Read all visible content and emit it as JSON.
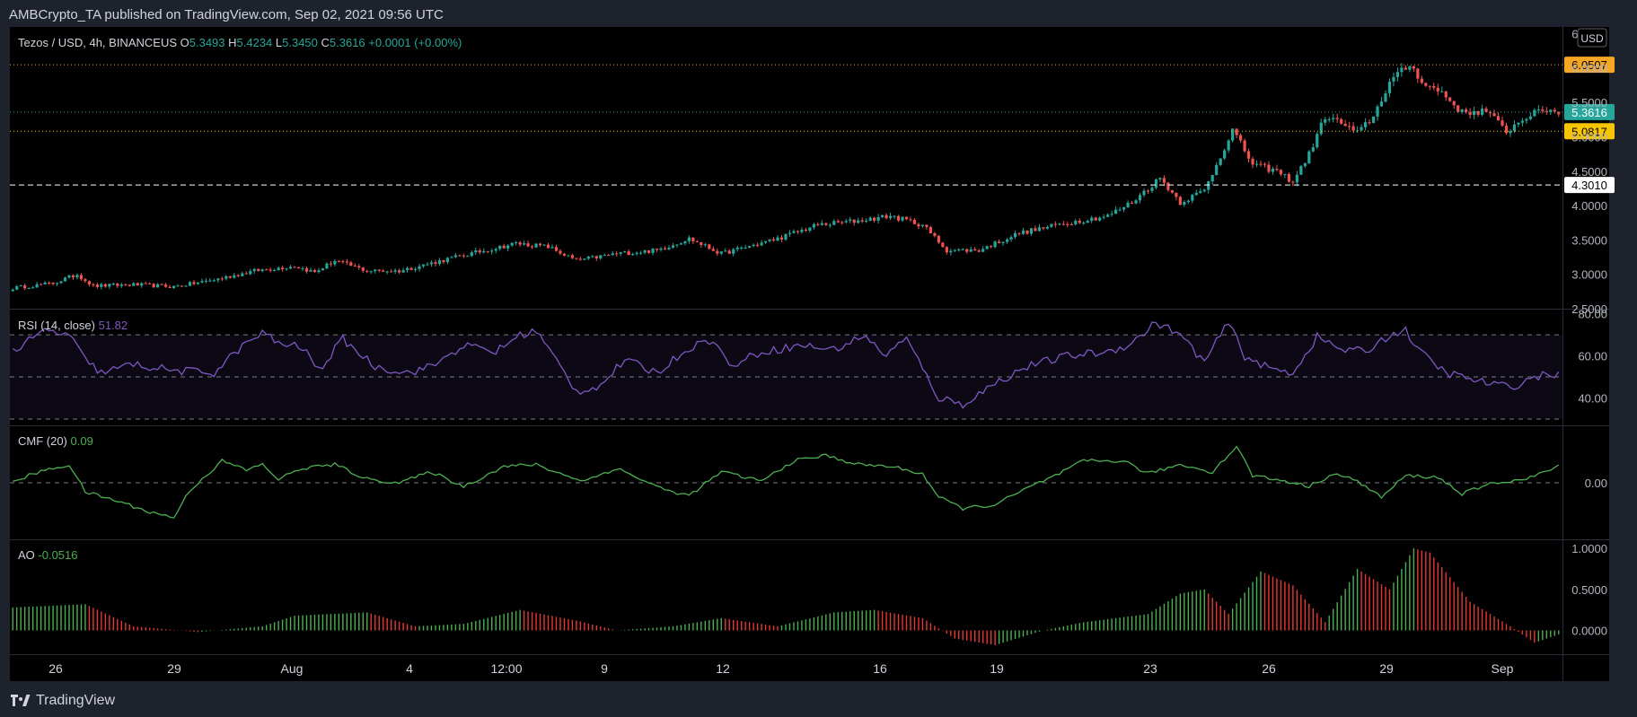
{
  "header": {
    "published_text": "AMBCrypto_TA published on TradingView.com, Sep 02, 2021 09:56 UTC"
  },
  "footer": {
    "brand": "TradingView",
    "logo_icon": "tradingview-logo-icon"
  },
  "colors": {
    "background": "#000000",
    "frame": "#1e222d",
    "up": "#26a69a",
    "down": "#ef5350",
    "rsi": "#7e57c2",
    "cmf": "#4caf50",
    "ao_up": "#4caf50",
    "ao_down": "#e53935",
    "level_yellow": "#f7c600",
    "level_orange": "#f5a623"
  },
  "chart_data": [
    {
      "type": "candlestick",
      "symbol": "Tezos / USD, 4h, BINANCEUS",
      "ohlc_label": {
        "o_label": "O",
        "o_value": "5.3493",
        "h_label": "H",
        "h_value": "5.4234",
        "l_label": "L",
        "l_value": "5.3450",
        "c_label": "C",
        "c_value": "5.3616",
        "change": "+0.0001 (+0.00%)"
      },
      "currency_button": "USD",
      "ylim": [
        2.5,
        6.6
      ],
      "y_ticks": [
        "6.5000",
        "6.0000",
        "5.5000",
        "5.0000",
        "4.5000",
        "4.0000",
        "3.5000",
        "3.0000",
        "2.5000"
      ],
      "x_tick_labels": [
        "26",
        "29",
        "Aug",
        "4",
        "12:00",
        "9",
        "12",
        "16",
        "19",
        "23",
        "26",
        "29",
        "Sep"
      ],
      "close_anchors": [
        [
          0,
          2.8
        ],
        [
          10,
          2.87
        ],
        [
          16,
          3.0
        ],
        [
          20,
          2.83
        ],
        [
          30,
          2.85
        ],
        [
          40,
          2.82
        ],
        [
          50,
          2.92
        ],
        [
          60,
          3.05
        ],
        [
          70,
          3.12
        ],
        [
          75,
          3.03
        ],
        [
          80,
          3.2
        ],
        [
          88,
          3.05
        ],
        [
          96,
          3.05
        ],
        [
          110,
          3.25
        ],
        [
          125,
          3.45
        ],
        [
          133,
          3.4
        ],
        [
          140,
          3.2
        ],
        [
          150,
          3.3
        ],
        [
          160,
          3.35
        ],
        [
          168,
          3.52
        ],
        [
          176,
          3.3
        ],
        [
          190,
          3.52
        ],
        [
          200,
          3.72
        ],
        [
          210,
          3.78
        ],
        [
          218,
          3.85
        ],
        [
          226,
          3.72
        ],
        [
          232,
          3.35
        ],
        [
          240,
          3.35
        ],
        [
          250,
          3.6
        ],
        [
          262,
          3.75
        ],
        [
          272,
          3.85
        ],
        [
          278,
          4.05
        ],
        [
          285,
          4.4
        ],
        [
          290,
          4.05
        ],
        [
          296,
          4.22
        ],
        [
          303,
          5.1
        ],
        [
          308,
          4.6
        ],
        [
          314,
          4.5
        ],
        [
          318,
          4.35
        ],
        [
          322,
          4.75
        ],
        [
          326,
          5.3
        ],
        [
          330,
          5.2
        ],
        [
          334,
          5.05
        ],
        [
          338,
          5.3
        ],
        [
          342,
          5.8
        ],
        [
          347,
          6.05
        ],
        [
          351,
          5.75
        ],
        [
          355,
          5.65
        ],
        [
          360,
          5.35
        ],
        [
          366,
          5.38
        ],
        [
          371,
          5.08
        ],
        [
          376,
          5.3
        ],
        [
          381,
          5.4
        ],
        [
          384,
          5.36
        ]
      ],
      "levels": [
        {
          "label": "6.0507",
          "value": 6.0507,
          "style": "dotted",
          "color": "#f5a623"
        },
        {
          "label": "5.3616",
          "value": 5.3616,
          "style": "dotted",
          "color": "#26a69a"
        },
        {
          "label": "5.0817",
          "value": 5.0817,
          "style": "dotted",
          "color": "#f7c600"
        },
        {
          "label": "4.3010",
          "value": 4.301,
          "style": "dashed",
          "color": "#ffffff"
        }
      ]
    },
    {
      "type": "line",
      "name": "RSI (14, close)",
      "current_value": "51.82",
      "ylim": [
        27,
        82
      ],
      "band": [
        30,
        70
      ],
      "y_ticks": [
        "80.00",
        "60.00",
        "40.00"
      ],
      "values_anchors": [
        [
          0,
          62
        ],
        [
          8,
          72
        ],
        [
          14,
          70
        ],
        [
          18,
          58
        ],
        [
          22,
          52
        ],
        [
          30,
          56
        ],
        [
          40,
          53
        ],
        [
          50,
          52
        ],
        [
          56,
          63
        ],
        [
          62,
          71
        ],
        [
          66,
          66
        ],
        [
          72,
          64
        ],
        [
          76,
          53
        ],
        [
          82,
          68
        ],
        [
          90,
          55
        ],
        [
          98,
          52
        ],
        [
          104,
          55
        ],
        [
          112,
          65
        ],
        [
          120,
          62
        ],
        [
          126,
          70
        ],
        [
          130,
          72
        ],
        [
          136,
          55
        ],
        [
          140,
          43
        ],
        [
          146,
          46
        ],
        [
          152,
          58
        ],
        [
          160,
          52
        ],
        [
          168,
          64
        ],
        [
          174,
          68
        ],
        [
          178,
          55
        ],
        [
          186,
          62
        ],
        [
          196,
          65
        ],
        [
          204,
          63
        ],
        [
          212,
          70
        ],
        [
          216,
          60
        ],
        [
          222,
          68
        ],
        [
          230,
          40
        ],
        [
          236,
          37
        ],
        [
          244,
          47
        ],
        [
          252,
          55
        ],
        [
          262,
          60
        ],
        [
          272,
          62
        ],
        [
          278,
          66
        ],
        [
          284,
          76
        ],
        [
          290,
          70
        ],
        [
          296,
          57
        ],
        [
          302,
          76
        ],
        [
          306,
          60
        ],
        [
          312,
          54
        ],
        [
          318,
          52
        ],
        [
          324,
          69
        ],
        [
          330,
          63
        ],
        [
          336,
          62
        ],
        [
          342,
          70
        ],
        [
          346,
          72
        ],
        [
          350,
          61
        ],
        [
          356,
          52
        ],
        [
          364,
          48
        ],
        [
          372,
          45
        ],
        [
          378,
          50
        ],
        [
          384,
          52
        ]
      ]
    },
    {
      "type": "line",
      "name": "CMF (20)",
      "current_value": "0.09",
      "ylim": [
        -0.31,
        0.31
      ],
      "y_ticks": [
        "0.00"
      ],
      "values_anchors": [
        [
          0,
          0.0
        ],
        [
          5,
          0.05
        ],
        [
          14,
          0.1
        ],
        [
          18,
          -0.05
        ],
        [
          26,
          -0.1
        ],
        [
          34,
          -0.16
        ],
        [
          40,
          -0.19
        ],
        [
          44,
          -0.04
        ],
        [
          52,
          0.12
        ],
        [
          58,
          0.07
        ],
        [
          62,
          0.1
        ],
        [
          66,
          0.02
        ],
        [
          72,
          0.08
        ],
        [
          80,
          0.1
        ],
        [
          88,
          0.02
        ],
        [
          96,
          0.0
        ],
        [
          104,
          0.06
        ],
        [
          112,
          -0.02
        ],
        [
          122,
          0.09
        ],
        [
          130,
          0.1
        ],
        [
          136,
          0.05
        ],
        [
          142,
          0.01
        ],
        [
          150,
          0.08
        ],
        [
          156,
          0.02
        ],
        [
          162,
          -0.04
        ],
        [
          168,
          -0.07
        ],
        [
          176,
          0.06
        ],
        [
          186,
          0.01
        ],
        [
          194,
          0.12
        ],
        [
          202,
          0.15
        ],
        [
          210,
          0.1
        ],
        [
          218,
          0.09
        ],
        [
          226,
          0.05
        ],
        [
          230,
          -0.08
        ],
        [
          236,
          -0.14
        ],
        [
          244,
          -0.12
        ],
        [
          252,
          -0.03
        ],
        [
          260,
          0.05
        ],
        [
          266,
          0.12
        ],
        [
          276,
          0.12
        ],
        [
          282,
          0.05
        ],
        [
          290,
          0.1
        ],
        [
          298,
          0.06
        ],
        [
          304,
          0.2
        ],
        [
          308,
          0.04
        ],
        [
          316,
          0.01
        ],
        [
          322,
          -0.02
        ],
        [
          328,
          0.05
        ],
        [
          334,
          0.01
        ],
        [
          340,
          -0.08
        ],
        [
          346,
          0.04
        ],
        [
          354,
          0.03
        ],
        [
          360,
          -0.06
        ],
        [
          368,
          0.0
        ],
        [
          376,
          0.02
        ],
        [
          384,
          0.09
        ]
      ]
    },
    {
      "type": "bar",
      "name": "AO",
      "current_value": "-0.0516",
      "ylim": [
        -0.29,
        1.1
      ],
      "y_ticks": [
        "1.0000",
        "0.5000",
        "0.0000"
      ],
      "values_anchors": [
        [
          0,
          0.28
        ],
        [
          18,
          0.32
        ],
        [
          30,
          0.05
        ],
        [
          46,
          -0.02
        ],
        [
          62,
          0.05
        ],
        [
          70,
          0.18
        ],
        [
          88,
          0.22
        ],
        [
          100,
          0.05
        ],
        [
          112,
          0.08
        ],
        [
          126,
          0.25
        ],
        [
          140,
          0.12
        ],
        [
          150,
          0.0
        ],
        [
          164,
          0.05
        ],
        [
          176,
          0.15
        ],
        [
          190,
          0.05
        ],
        [
          204,
          0.22
        ],
        [
          214,
          0.25
        ],
        [
          226,
          0.15
        ],
        [
          234,
          -0.1
        ],
        [
          244,
          -0.18
        ],
        [
          256,
          0.0
        ],
        [
          266,
          0.1
        ],
        [
          282,
          0.2
        ],
        [
          290,
          0.45
        ],
        [
          296,
          0.5
        ],
        [
          302,
          0.2
        ],
        [
          310,
          0.72
        ],
        [
          318,
          0.55
        ],
        [
          326,
          0.1
        ],
        [
          334,
          0.75
        ],
        [
          342,
          0.5
        ],
        [
          348,
          1.0
        ],
        [
          352,
          0.95
        ],
        [
          362,
          0.35
        ],
        [
          372,
          0.05
        ],
        [
          378,
          -0.15
        ],
        [
          384,
          -0.05
        ]
      ]
    }
  ]
}
